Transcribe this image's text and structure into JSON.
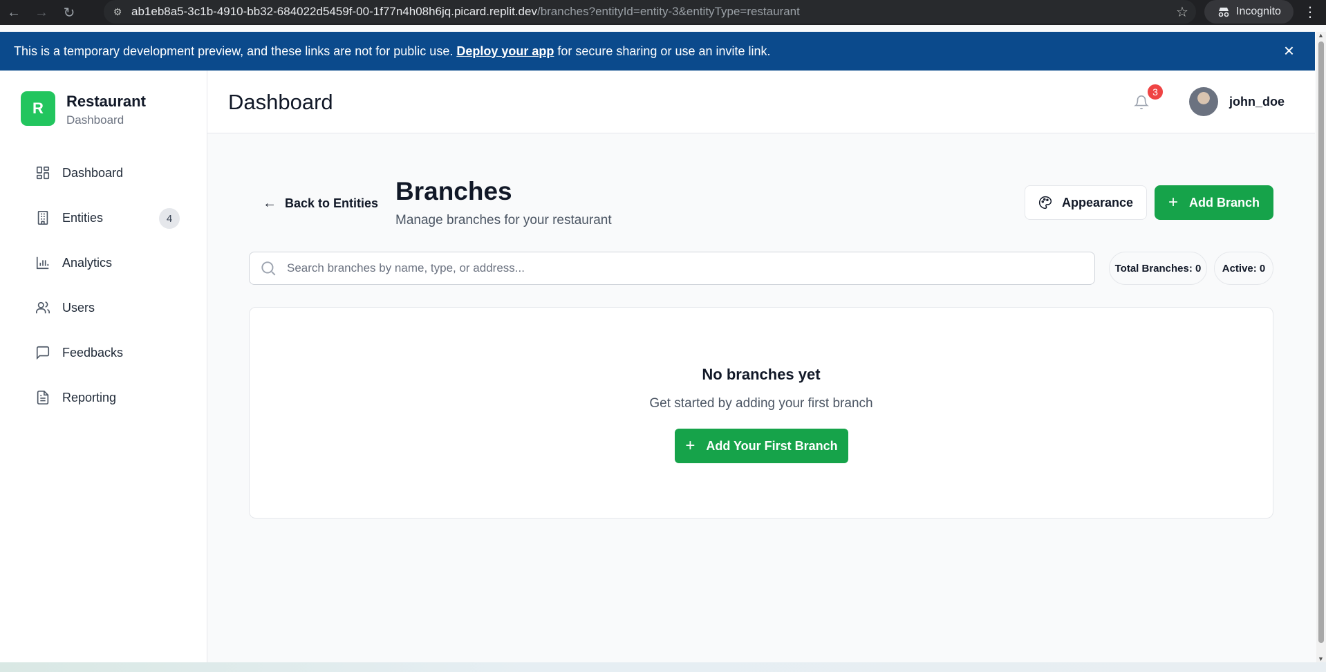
{
  "browser": {
    "url_host": "ab1eb8a5-3c1b-4910-bb32-684022d5459f-00-1f77n4h08h6jq.picard.replit.dev",
    "url_path": "/branches?entityId=entity-3&entityType=restaurant",
    "incognito_label": "Incognito"
  },
  "banner": {
    "text_before": "This is a temporary development preview, and these links are not for public use. ",
    "link_text": "Deploy your app",
    "text_after": " for secure sharing or use an invite link."
  },
  "sidebar": {
    "brand_initial": "R",
    "brand_title": "Restaurant",
    "brand_subtitle": "Dashboard",
    "items": [
      {
        "label": "Dashboard",
        "icon": "grid-icon"
      },
      {
        "label": "Entities",
        "icon": "building-icon",
        "badge": "4"
      },
      {
        "label": "Analytics",
        "icon": "bar-chart-icon"
      },
      {
        "label": "Users",
        "icon": "users-icon"
      },
      {
        "label": "Feedbacks",
        "icon": "message-icon"
      },
      {
        "label": "Reporting",
        "icon": "document-icon"
      }
    ]
  },
  "header": {
    "title": "Dashboard",
    "notification_count": "3",
    "username": "john_doe"
  },
  "page": {
    "back_label": "Back to Entities",
    "title": "Branches",
    "subtitle": "Manage branches for your restaurant",
    "appearance_label": "Appearance",
    "add_label": "Add Branch",
    "search_placeholder": "Search branches by name, type, or address...",
    "search_value": "",
    "total_label": "Total Branches: 0",
    "active_label": "Active: 0",
    "empty_title": "No branches yet",
    "empty_desc": "Get started by adding your first branch",
    "empty_button": "Add Your First Branch"
  },
  "colors": {
    "primary": "#16a34a",
    "banner": "#0b4a8c",
    "badge": "#ef4444"
  }
}
